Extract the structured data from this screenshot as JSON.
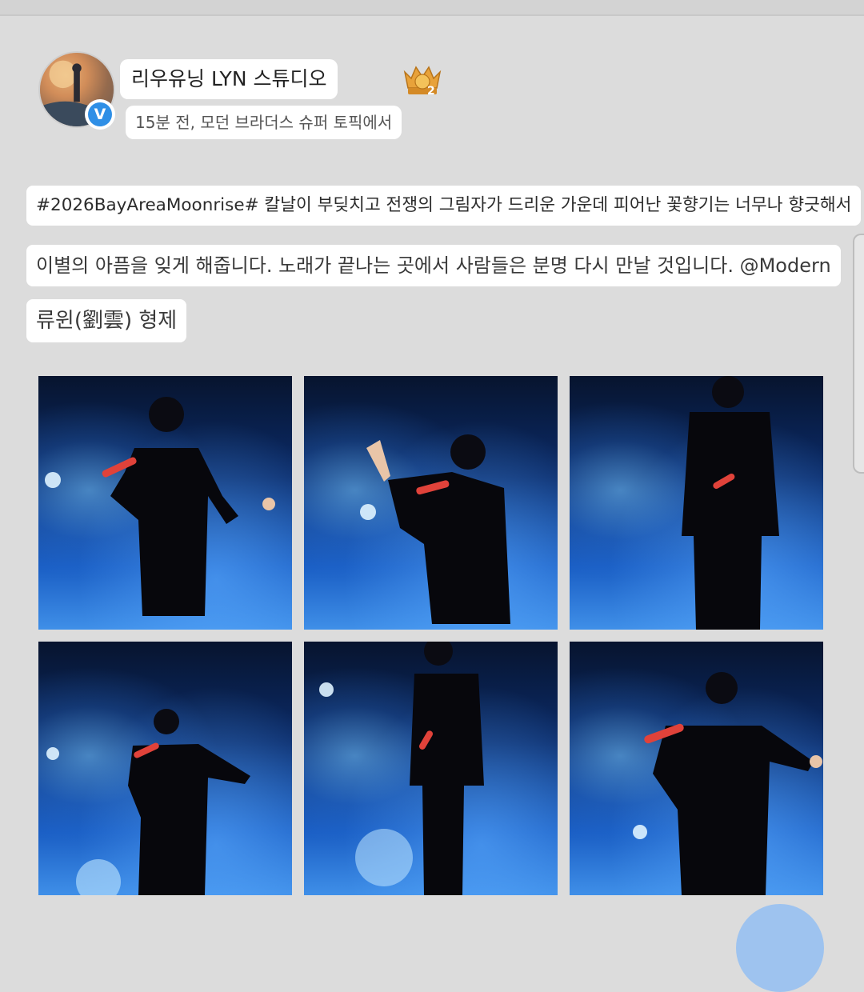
{
  "post": {
    "author_name": "리우유닝 LYN 스튜디오",
    "meta": "15분 전, 모던 브라더스 슈퍼 토픽에서",
    "text_line_1": "#2026BayAreaMoonrise# 칼날이 부딪치고 전쟁의 그림자가 드리운 가운데 피어난 꽃향기는 너무나 향긋해서",
    "text_line_2": "이별의 아픔을 잊게 해줍니다. 노래가 끝나는 곳에서 사람들은 분명 다시 만날 것입니다. @Modern",
    "text_line_3": "류윈(劉雲) 형제",
    "verified_mark": "V",
    "badge_number": "2",
    "photo_count": 6
  },
  "colors": {
    "background": "#dcdcdc",
    "pill": "#ffffff",
    "verified": "#2f8fe6",
    "badge_gold": "#e8a23a",
    "stage_blue": "#1a5ec4"
  },
  "icons": {
    "verified": "verified-check-icon",
    "badge": "gold-crown-badge-icon"
  }
}
